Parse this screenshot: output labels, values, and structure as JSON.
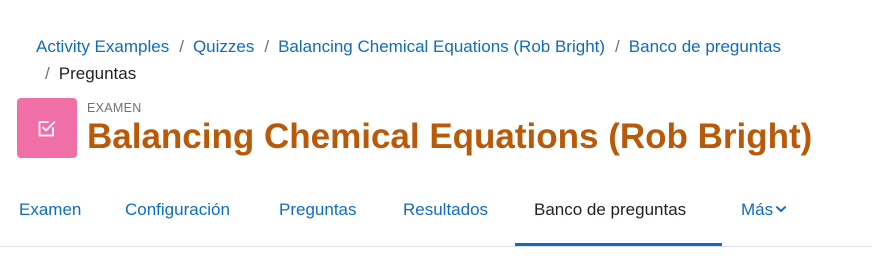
{
  "breadcrumb": {
    "items": [
      "Activity Examples",
      "Quizzes",
      "Balancing Chemical Equations (Rob Bright)",
      "Banco de preguntas"
    ],
    "separator": "/",
    "current": "Preguntas"
  },
  "header": {
    "icon": "quiz-checkbox-icon",
    "icon_color": "#ef6fa6",
    "activity_type": "EXAMEN",
    "title": "Balancing Chemical Equations (Rob Bright)",
    "title_color": "#b85a0a"
  },
  "tabs": {
    "items": [
      "Examen",
      "Configuración",
      "Preguntas",
      "Resultados",
      "Banco de preguntas",
      "Más"
    ],
    "active": "Banco de preguntas",
    "more_icon": "chevron-down-icon"
  },
  "colors": {
    "link": "#0f6cbf",
    "text": "#1d2125"
  }
}
